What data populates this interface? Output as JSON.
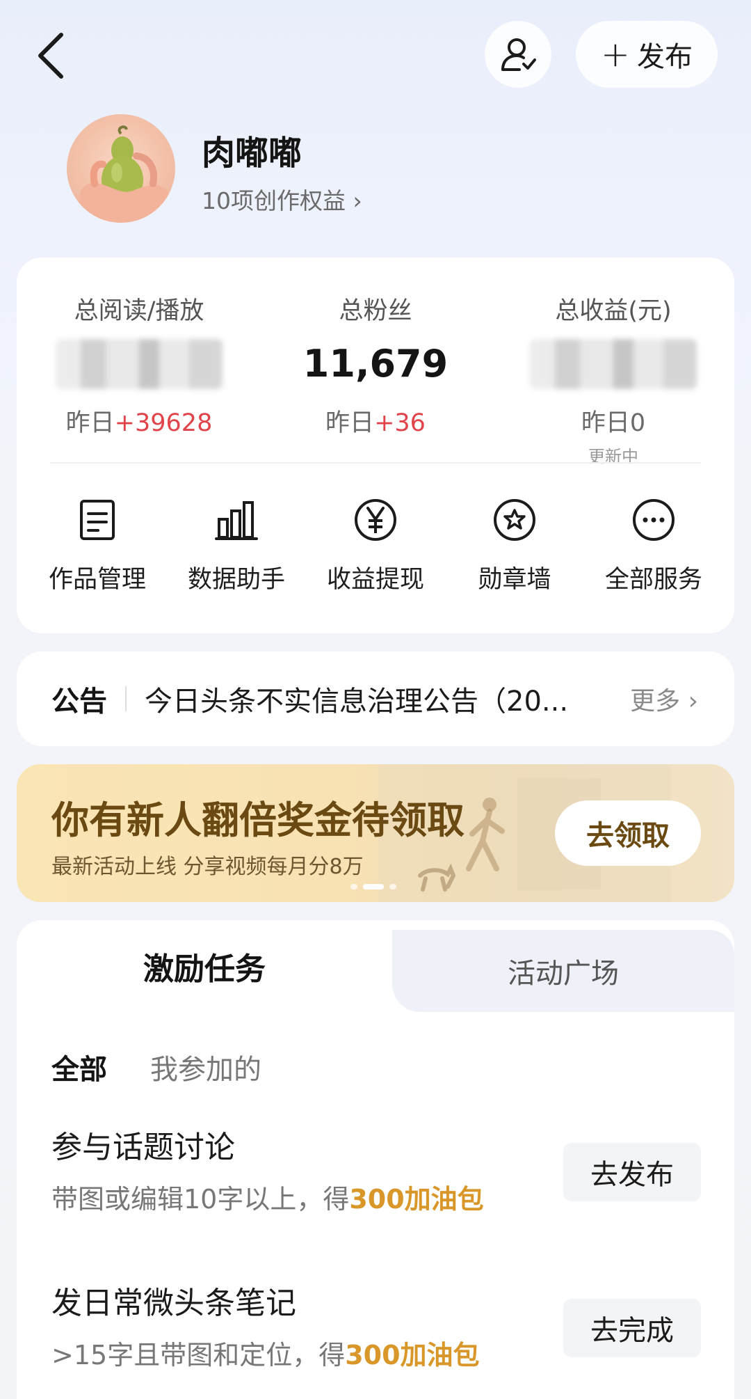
{
  "header": {
    "back_icon": "chevron-left-icon",
    "follow_icon": "user-check-icon",
    "publish_label": "发布"
  },
  "profile": {
    "name": "肉嘟嘟",
    "rights_link": "10项创作权益",
    "rights_chevron": "›"
  },
  "stats": [
    {
      "label": "总阅读/播放",
      "value_hidden": true,
      "change_prefix": "昨日",
      "change_value": "+39628",
      "note": ""
    },
    {
      "label": "总粉丝",
      "value": "11,679",
      "change_prefix": "昨日",
      "change_value": "+36",
      "note": ""
    },
    {
      "label": "总收益(元)",
      "value_hidden": true,
      "change_prefix": "昨日0",
      "change_value": "",
      "note": "更新中"
    }
  ],
  "services": [
    {
      "label": "作品管理",
      "icon": "document-icon"
    },
    {
      "label": "数据助手",
      "icon": "bar-chart-icon"
    },
    {
      "label": "收益提现",
      "icon": "yen-icon"
    },
    {
      "label": "勋章墙",
      "icon": "medal-icon"
    },
    {
      "label": "全部服务",
      "icon": "more-icon"
    }
  ],
  "notice": {
    "tag": "公告",
    "text": "今日头条不实信息治理公告（20...",
    "more": "更多",
    "more_chevron": "›"
  },
  "banner": {
    "title": "你有新人翻倍奖金待领取",
    "subtitle": "最新活动上线 分享视频每月分8万",
    "button": "去领取",
    "active_dot": 2,
    "dot_count": 3
  },
  "tasks": {
    "tabs": [
      "激励任务",
      "活动广场"
    ],
    "filters": [
      "全部",
      "我参加的"
    ],
    "items": [
      {
        "title": "参与话题讨论",
        "desc": "带图或编辑10字以上，得",
        "reward": "300加油包",
        "button": "去发布"
      },
      {
        "title": "发日常微头条笔记",
        "desc": ">15字且带图和定位，得",
        "reward": "300加油包",
        "button": "去完成"
      }
    ]
  },
  "colors": {
    "accent_red": "#e1434b",
    "reward_gold": "#d9972a",
    "banner_brown": "#6a4a12"
  }
}
